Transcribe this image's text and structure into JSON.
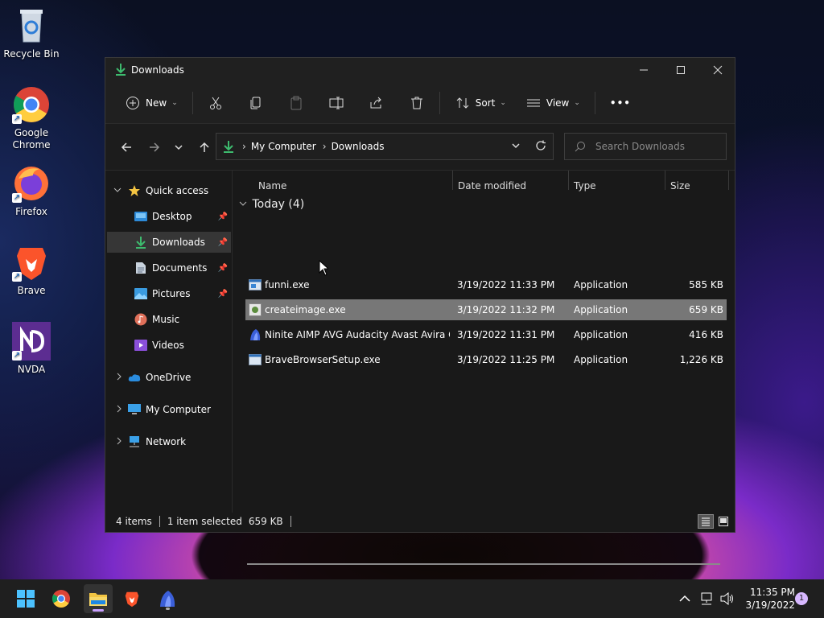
{
  "desktop": {
    "icons": [
      {
        "label": "Recycle Bin",
        "icon": "recycle-bin-icon"
      },
      {
        "label": "Google Chrome",
        "icon": "chrome-icon"
      },
      {
        "label": "Firefox",
        "icon": "firefox-icon"
      },
      {
        "label": "Brave",
        "icon": "brave-icon"
      },
      {
        "label": "NVDA",
        "icon": "nvda-icon"
      }
    ]
  },
  "window": {
    "title": "Downloads",
    "toolbar": {
      "new_label": "New",
      "sort_label": "Sort",
      "view_label": "View",
      "more_label": "•••"
    },
    "address": {
      "crumbs": [
        "My Computer",
        "Downloads"
      ],
      "sep": "›"
    },
    "search": {
      "placeholder": "Search Downloads"
    },
    "sidebar": {
      "quick_access": "Quick access",
      "items": [
        {
          "label": "Desktop",
          "pinned": true
        },
        {
          "label": "Downloads",
          "pinned": true,
          "selected": true
        },
        {
          "label": "Documents",
          "pinned": true
        },
        {
          "label": "Pictures",
          "pinned": true
        },
        {
          "label": "Music",
          "pinned": false
        },
        {
          "label": "Videos",
          "pinned": false
        }
      ],
      "roots": [
        "OneDrive",
        "My Computer",
        "Network"
      ]
    },
    "columns": {
      "name": "Name",
      "date": "Date modified",
      "type": "Type",
      "size": "Size"
    },
    "group": "Today (4)",
    "files": [
      {
        "name": "funni.exe",
        "date": "3/19/2022 11:33 PM",
        "type": "Application",
        "size": "585 KB"
      },
      {
        "name": "createimage.exe",
        "date": "3/19/2022 11:32 PM",
        "type": "Application",
        "size": "659 KB",
        "selected": true
      },
      {
        "name": "Ninite AIMP AVG Audacity Avast Avira C...",
        "date": "3/19/2022 11:31 PM",
        "type": "Application",
        "size": "416 KB"
      },
      {
        "name": "BraveBrowserSetup.exe",
        "date": "3/19/2022 11:25 PM",
        "type": "Application",
        "size": "1,226 KB"
      }
    ],
    "status": {
      "items": "4 items",
      "selected": "1 item selected",
      "size": "659 KB"
    }
  },
  "taskbar": {
    "time": "11:35 PM",
    "date": "3/19/2022",
    "notification_count": "1"
  },
  "colors": {
    "accent": "#4cc2ff",
    "download_green": "#3dbb6e",
    "selection": "#777777"
  }
}
